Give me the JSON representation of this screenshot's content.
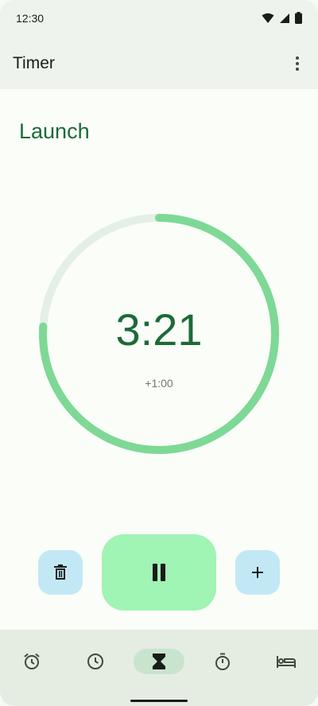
{
  "status_bar": {
    "time": "12:30"
  },
  "app_bar": {
    "title": "Timer"
  },
  "timer": {
    "label": "Launch",
    "remaining": "3:21",
    "add_minute_label": "+1:00",
    "progress_fraction": 0.76
  },
  "controls": {
    "delete_icon": "trash-icon",
    "pause_icon": "pause-icon",
    "add_icon": "plus-icon"
  },
  "bottom_nav": {
    "items": [
      {
        "icon": "alarm-icon",
        "active": false
      },
      {
        "icon": "clock-icon",
        "active": false
      },
      {
        "icon": "hourglass-icon",
        "active": true
      },
      {
        "icon": "stopwatch-icon",
        "active": false
      },
      {
        "icon": "bed-icon",
        "active": false
      }
    ]
  },
  "colors": {
    "accent": "#1b6b37",
    "progress": "#7ed896",
    "track": "#e4efe5",
    "pause_button": "#a0f4b4",
    "secondary_button": "#c3e8f5"
  }
}
